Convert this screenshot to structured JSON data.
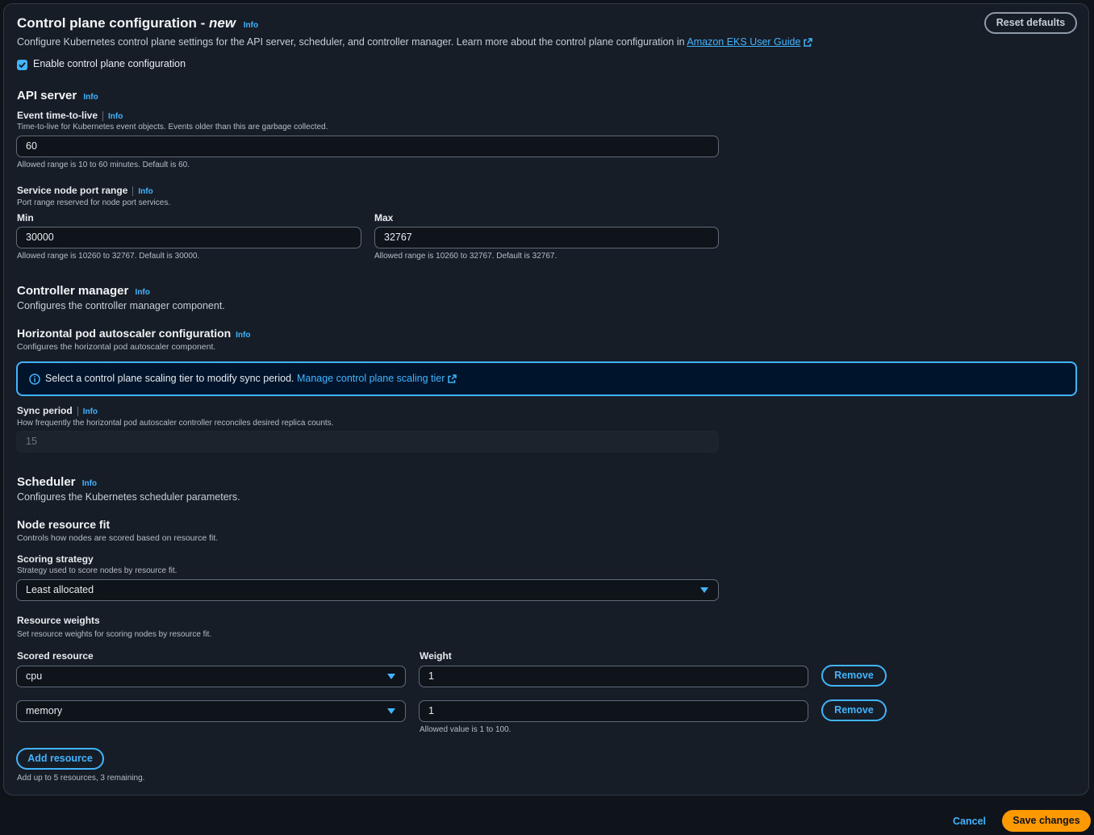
{
  "header": {
    "title": "Control plane configuration - ",
    "title_new": "new",
    "info": "Info",
    "reset_label": "Reset defaults",
    "description": "Configure Kubernetes control plane settings for the API server, scheduler, and controller manager. Learn more about the control plane configuration in ",
    "guide_link": "Amazon EKS User Guide",
    "enable_label": "Enable control plane configuration",
    "enable_checked": true
  },
  "api_server": {
    "title": "API server",
    "info": "Info",
    "event_ttl": {
      "label": "Event time-to-live",
      "info": "Info",
      "description": "Time-to-live for Kubernetes event objects. Events older than this are garbage collected.",
      "value": "60",
      "constraint": "Allowed range is 10 to 60 minutes. Default is 60."
    },
    "port_range": {
      "label": "Service node port range",
      "info": "Info",
      "description": "Port range reserved for node port services.",
      "min_label": "Min",
      "min_value": "30000",
      "min_constraint": "Allowed range is 10260 to 32767. Default is 30000.",
      "max_label": "Max",
      "max_value": "32767",
      "max_constraint": "Allowed range is 10260 to 32767. Default is 32767."
    }
  },
  "controller_manager": {
    "title": "Controller manager",
    "info": "Info",
    "description": "Configures the controller manager component.",
    "hpa": {
      "title": "Horizontal pod autoscaler configuration",
      "info": "Info",
      "description": "Configures the horizontal pod autoscaler component."
    },
    "alert": {
      "text": "Select a control plane scaling tier to modify sync period. ",
      "link": "Manage control plane scaling tier"
    },
    "sync_period": {
      "label": "Sync period",
      "info": "Info",
      "description": "How frequently the horizontal pod autoscaler controller reconciles desired replica counts.",
      "value": "15"
    }
  },
  "scheduler": {
    "title": "Scheduler",
    "info": "Info",
    "description": "Configures the Kubernetes scheduler parameters.",
    "node_fit": {
      "title": "Node resource fit",
      "description": "Controls how nodes are scored based on resource fit."
    },
    "scoring": {
      "label": "Scoring strategy",
      "description": "Strategy used to score nodes by resource fit.",
      "value": "Least allocated"
    },
    "weights": {
      "label": "Resource weights",
      "description": "Set resource weights for scoring nodes by resource fit.",
      "col_resource": "Scored resource",
      "col_weight": "Weight",
      "rows": [
        {
          "resource": "cpu",
          "weight": "1",
          "remove": "Remove"
        },
        {
          "resource": "memory",
          "weight": "1",
          "remove": "Remove"
        }
      ],
      "weight_constraint": "Allowed value is 1 to 100.",
      "add_label": "Add resource",
      "add_constraint": "Add up to 5 resources, 3 remaining."
    }
  },
  "footer": {
    "cancel": "Cancel",
    "save": "Save changes"
  },
  "colors": {
    "accent": "#42b4ff",
    "primary_button": "#ff9900",
    "background": "#0f141a",
    "panel": "#161d26"
  }
}
